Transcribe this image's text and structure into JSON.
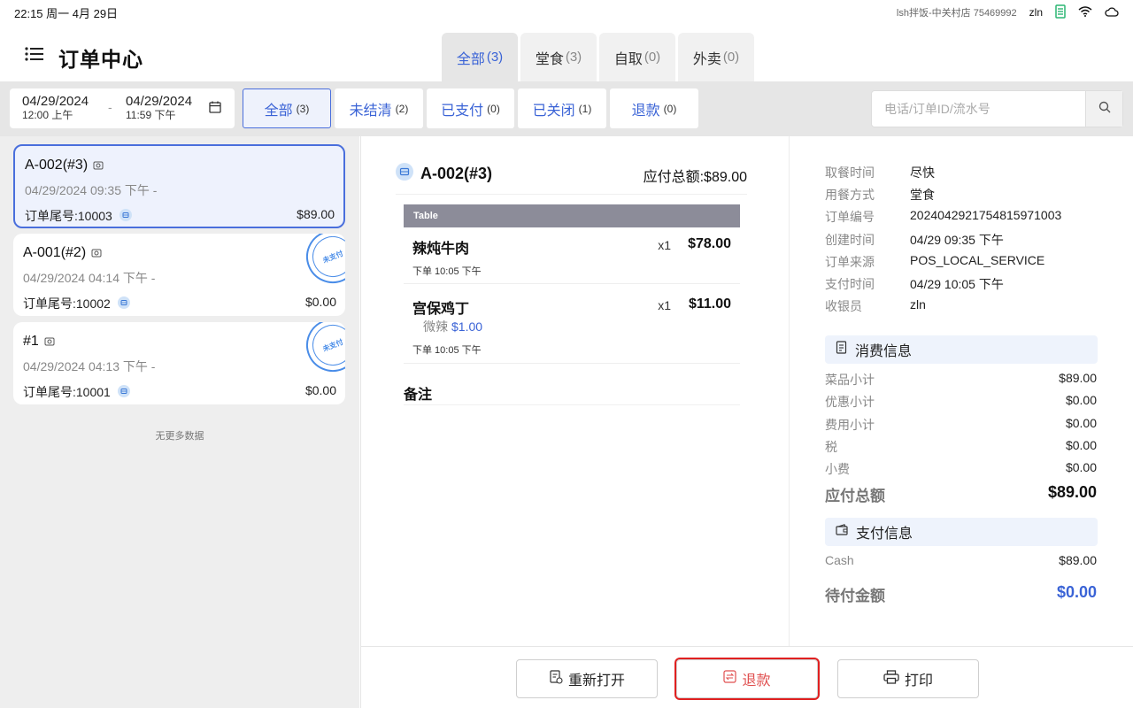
{
  "status_bar": {
    "time": "22:15 周一 4月 29日",
    "store": "lsh拌饭-中关村店  75469992",
    "user": "zln"
  },
  "header": {
    "title": "订单中心",
    "type_tabs": [
      {
        "label": "全部",
        "count": "(3)",
        "active": true
      },
      {
        "label": "堂食",
        "count": "(3)",
        "active": false
      },
      {
        "label": "自取",
        "count": "(0)",
        "active": false
      },
      {
        "label": "外卖",
        "count": "(0)",
        "active": false
      }
    ]
  },
  "filter": {
    "start_date": "04/29/2024",
    "start_time": "12:00 上午",
    "end_date": "04/29/2024",
    "end_time": "11:59 下午",
    "separator": "-",
    "status_tabs": [
      {
        "label": "全部",
        "count": "(3)",
        "active": true
      },
      {
        "label": "未结清",
        "count": "(2)",
        "active": false
      },
      {
        "label": "已支付",
        "count": "(0)",
        "active": false
      },
      {
        "label": "已关闭",
        "count": "(1)",
        "active": false
      },
      {
        "label": "退款",
        "count": "(0)",
        "active": false
      }
    ],
    "search_placeholder": "电话/订单ID/流水号"
  },
  "orders": [
    {
      "title": "A-002(#3)",
      "time": "04/29/2024 09:35 下午   -",
      "tail": "订单尾号:10003",
      "amount": "$89.00",
      "selected": true,
      "stamp": ""
    },
    {
      "title": "A-001(#2)",
      "time": "04/29/2024 04:14 下午   -",
      "tail": "订单尾号:10002",
      "amount": "$0.00",
      "selected": false,
      "stamp": "未支付"
    },
    {
      "title": "#1",
      "time": "04/29/2024 04:13 下午   -",
      "tail": "订单尾号:10001",
      "amount": "$0.00",
      "selected": false,
      "stamp": "未支付"
    }
  ],
  "no_more": "无更多数据",
  "detail": {
    "title": "A-002(#3)",
    "total": "应付总额:$89.00",
    "table_label": "Table",
    "items": [
      {
        "name": "辣炖牛肉",
        "qty": "x1",
        "price": "$78.00",
        "modifier": "",
        "modifier_price": "",
        "order_time": "下单 10:05 下午"
      },
      {
        "name": "宫保鸡丁",
        "qty": "x1",
        "price": "$11.00",
        "modifier": "微辣",
        "modifier_price": "$1.00",
        "order_time": "下单 10:05 下午"
      }
    ],
    "remark_label": "备注"
  },
  "info": {
    "rows": [
      {
        "label": "取餐时间",
        "value": "尽快"
      },
      {
        "label": "用餐方式",
        "value": "堂食"
      },
      {
        "label": "订单编号",
        "value": "2024042921754815971003"
      },
      {
        "label": "创建时间",
        "value": "04/29 09:35 下午"
      },
      {
        "label": "订单来源",
        "value": "POS_LOCAL_SERVICE"
      },
      {
        "label": "支付时间",
        "value": "04/29 10:05 下午"
      },
      {
        "label": "收银员",
        "value": "zln"
      }
    ],
    "consume_title": "消费信息",
    "consume": [
      {
        "label": "菜品小计",
        "value": "$89.00"
      },
      {
        "label": "优惠小计",
        "value": "$0.00"
      },
      {
        "label": "费用小计",
        "value": "$0.00"
      },
      {
        "label": "税",
        "value": "$0.00"
      },
      {
        "label": "小费",
        "value": "$0.00"
      }
    ],
    "total_label": "应付总额",
    "total_value": "$89.00",
    "pay_title": "支付信息",
    "payments": [
      {
        "label": "Cash",
        "value": "$89.00"
      }
    ],
    "due_label": "待付金额",
    "due_value": "$0.00"
  },
  "actions": {
    "reopen": "重新打开",
    "refund": "退款",
    "print": "打印"
  },
  "colors": {
    "accent": "#3a63d6",
    "refund_highlight": "#e02020",
    "stamp": "#4a8de8"
  }
}
